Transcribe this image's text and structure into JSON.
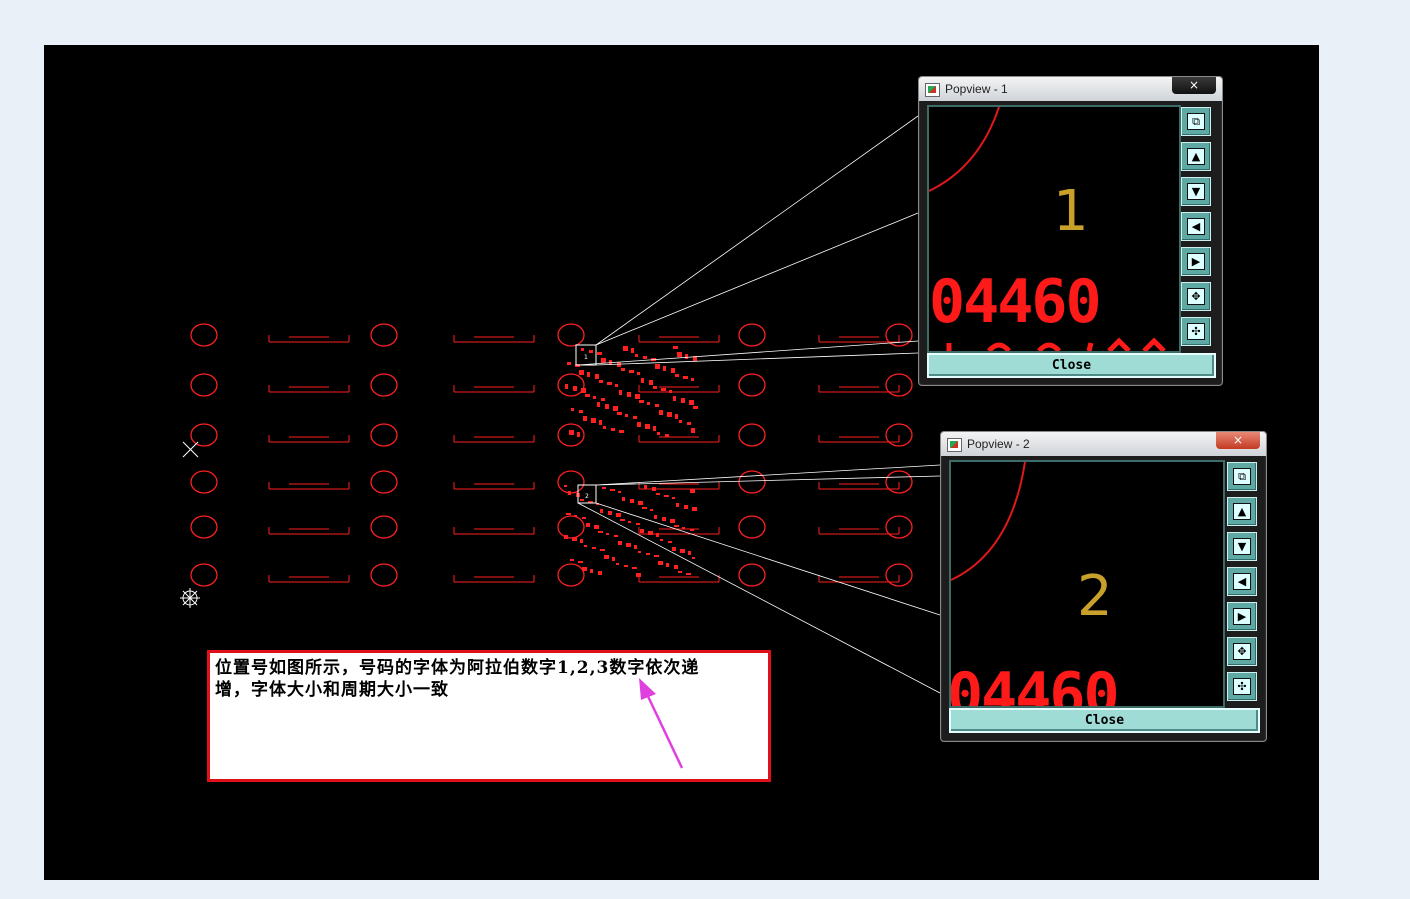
{
  "popviews": [
    {
      "title": "Popview - 1",
      "close_x": "×",
      "digit": "1",
      "big_text": "04460",
      "close_label": "Close"
    },
    {
      "title": "Popview - 2",
      "close_x": "×",
      "digit": "2",
      "big_text": "04460",
      "close_label": "Close"
    }
  ],
  "toolbar_icons": [
    "zoom-fit-icon",
    "pan-up-icon",
    "pan-down-icon",
    "pan-left-icon",
    "pan-right-icon",
    "zoom-out-icon",
    "zoom-in-icon"
  ],
  "markers": [
    "1",
    "2"
  ],
  "note": {
    "line1": "位置号如图所示，号码的字体为阿拉伯数字1,2,3数字依次递",
    "line2": "增，字体大小和周期大小一致"
  },
  "colors": {
    "board": "#000000",
    "trace": "#ff2020",
    "popview_button": "#9fdcd6",
    "digit": "#c8a02a",
    "arrow": "#e040e0",
    "note_border": "#e0101a"
  }
}
